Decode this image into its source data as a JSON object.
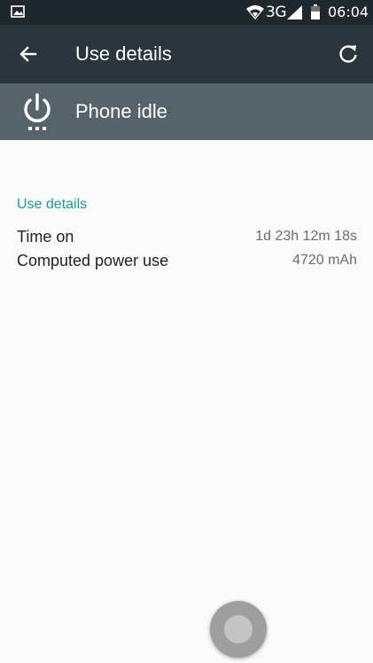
{
  "status_bar": {
    "network": "3G",
    "time": "06:04",
    "icons": [
      "gallery-icon",
      "wifi-icon",
      "signal-icon",
      "battery-icon"
    ]
  },
  "toolbar": {
    "title": "Use details",
    "back_icon": "arrow-back-icon",
    "refresh_icon": "refresh-icon"
  },
  "header": {
    "app_name": "Phone idle",
    "icon": "power-icon"
  },
  "details": {
    "section_title": "Use details",
    "rows": [
      {
        "label": "Time on",
        "value": "1d 23h 12m 18s"
      },
      {
        "label": "Computed power use",
        "value": "4720 mAh"
      }
    ]
  },
  "colors": {
    "status_bar": "#1f282d",
    "toolbar": "#2b363c",
    "header": "#55646b",
    "accent": "#1a9a8e",
    "background": "#fafafa"
  }
}
